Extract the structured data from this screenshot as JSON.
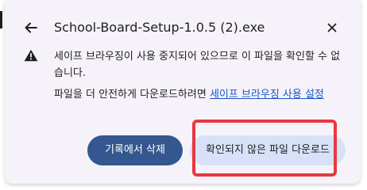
{
  "dialog": {
    "title": "School-Board-Setup-1.0.5 (2).exe",
    "back_icon": "arrow-left-icon",
    "close_icon": "close-icon",
    "warning_icon": "warning-triangle-icon",
    "message": "세이프 브라우징이 사용 중지되어 있으므로 이 파일을 확인할 수 없습니다.",
    "hint_text": "파일을 더 안전하게 다운로드하려면 ",
    "hint_link": "세이프 브라우징 사용 설정",
    "delete_button": "기록에서 삭제",
    "download_button": "확인되지 않은 파일 다운로드"
  },
  "colors": {
    "panel_bg": "#f6f2fa",
    "primary_button": "#33578e",
    "secondary_button": "#d7e2f8",
    "link": "#1a57c7",
    "highlight": "#e8383e"
  }
}
